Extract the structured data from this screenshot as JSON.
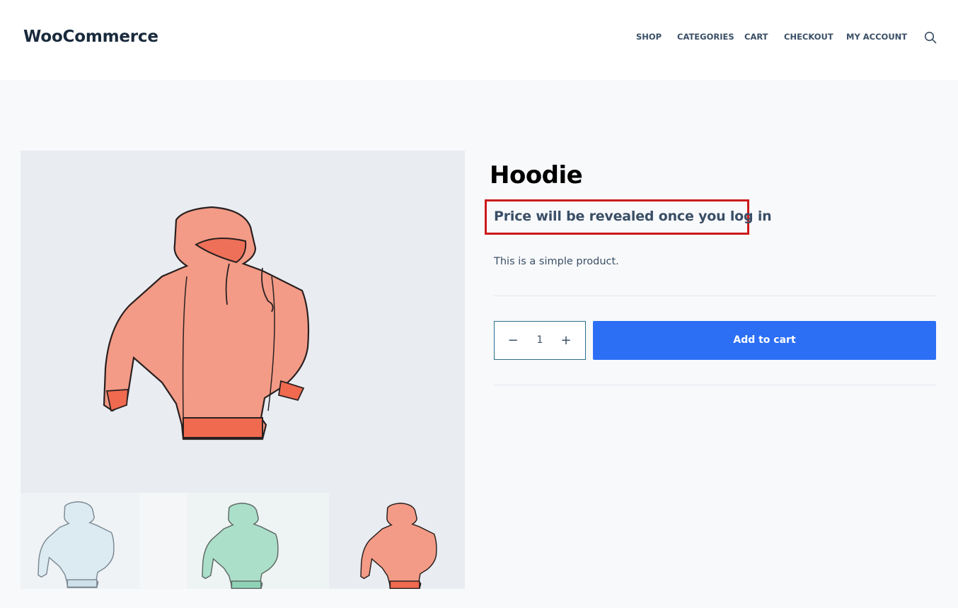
{
  "header": {
    "logo": "WooCommerce",
    "nav": [
      {
        "label": "SHOP"
      },
      {
        "label": "CATEGORIES"
      },
      {
        "label": "CART"
      },
      {
        "label": "CHECKOUT"
      },
      {
        "label": "MY ACCOUNT"
      }
    ],
    "search_icon": "search-icon"
  },
  "product": {
    "title": "Hoodie",
    "price_notice": "Price will be revealed once you log in",
    "description": "This is a simple product.",
    "quantity": "1",
    "minus_label": "−",
    "plus_label": "+",
    "add_to_cart_label": "Add to cart"
  },
  "gallery": {
    "main_image": "hoodie-orange",
    "thumbnails": [
      {
        "variant": "hoodie-light-blue"
      },
      {
        "variant": "hoodie-mint"
      },
      {
        "variant": "hoodie-orange"
      }
    ]
  },
  "colors": {
    "accent": "#2c6ff5",
    "highlight_border": "#cc1a1a",
    "hoodie_orange": "#f08a74",
    "hoodie_blue": "#d8e8f0",
    "hoodie_mint": "#a8dcc6"
  }
}
